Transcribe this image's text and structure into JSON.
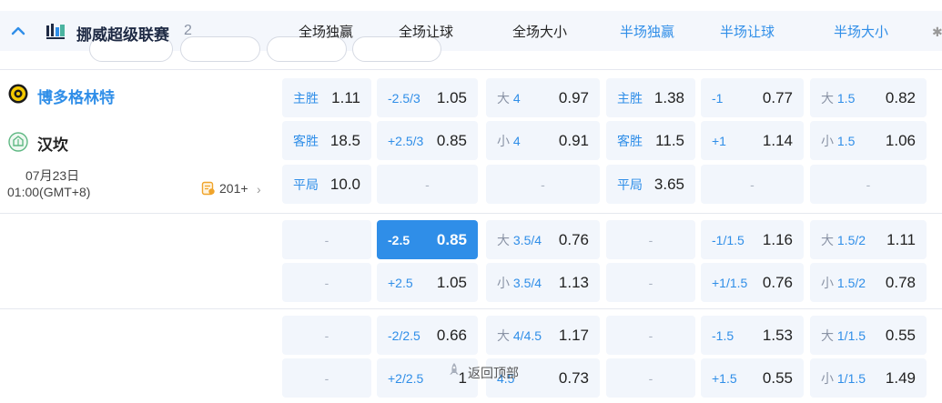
{
  "league": {
    "name": "挪威超级联赛",
    "count": "2",
    "colors": {
      "accent": "#2f8ee8",
      "home": "#2f8ee8"
    }
  },
  "columns": [
    "全场独赢",
    "全场让球",
    "全场大小",
    "半场独赢",
    "半场让球",
    "半场大小"
  ],
  "match": {
    "home_team": "博多格林特",
    "away_team": "汉坎",
    "date": "07月23日",
    "time": "01:00(GMT+8)",
    "more_markets": "201+"
  },
  "rows": [
    [
      {
        "label": "主胜",
        "value": "1.11"
      },
      {
        "label": "-2.5/3",
        "value": "1.05"
      },
      {
        "ou": "大",
        "line": "4",
        "value": "0.97"
      },
      {
        "label": "主胜",
        "value": "1.38"
      },
      {
        "label": "-1",
        "value": "0.77"
      },
      {
        "ou": "大",
        "line": "1.5",
        "value": "0.82"
      }
    ],
    [
      {
        "label": "客胜",
        "value": "18.5"
      },
      {
        "label": "+2.5/3",
        "value": "0.85"
      },
      {
        "ou": "小",
        "line": "4",
        "value": "0.91"
      },
      {
        "label": "客胜",
        "value": "11.5"
      },
      {
        "label": "+1",
        "value": "1.14"
      },
      {
        "ou": "小",
        "line": "1.5",
        "value": "1.06"
      }
    ],
    [
      {
        "label": "平局",
        "value": "10.0"
      },
      {
        "dash": "-"
      },
      {
        "dash": "-"
      },
      {
        "label": "平局",
        "value": "3.65"
      },
      {
        "dash": "-"
      },
      {
        "dash": "-"
      }
    ],
    [
      {
        "dash": "-"
      },
      {
        "label": "-2.5",
        "value": "0.85",
        "active": true
      },
      {
        "ou": "大",
        "line": "3.5/4",
        "value": "0.76"
      },
      {
        "dash": "-"
      },
      {
        "label": "-1/1.5",
        "value": "1.16"
      },
      {
        "ou": "大",
        "line": "1.5/2",
        "value": "1.11"
      }
    ],
    [
      {
        "dash": "-"
      },
      {
        "label": "+2.5",
        "value": "1.05"
      },
      {
        "ou": "小",
        "line": "3.5/4",
        "value": "1.13"
      },
      {
        "dash": "-"
      },
      {
        "label": "+1/1.5",
        "value": "0.76"
      },
      {
        "ou": "小",
        "line": "1.5/2",
        "value": "0.78"
      }
    ],
    [
      {
        "dash": "-"
      },
      {
        "label": "-2/2.5",
        "value": "0.66"
      },
      {
        "ou": "大",
        "line": "4/4.5",
        "value": "1.17"
      },
      {
        "dash": "-"
      },
      {
        "label": "-1.5",
        "value": "1.53"
      },
      {
        "ou": "大",
        "line": "1/1.5",
        "value": "0.55"
      }
    ],
    [
      {
        "dash": "-"
      },
      {
        "label": "+2/2.5",
        "value": "1"
      },
      {
        "ou": "",
        "line": "4.5",
        "value": "0.73"
      },
      {
        "dash": "-"
      },
      {
        "label": "+1.5",
        "value": "0.55"
      },
      {
        "ou": "小",
        "line": "1/1.5",
        "value": "1.49"
      }
    ]
  ],
  "back_to_top": "返回顶部",
  "icons": {
    "collapse": "chevron-up-icon",
    "league": "norway-league-icon",
    "home_badge": "bodo-glimt-badge-icon",
    "away_badge": "haugesund-badge-icon",
    "more": "market-list-icon",
    "chevron": "chevron-right-icon",
    "settings": "gear-icon",
    "back_top": "rocket-icon"
  }
}
